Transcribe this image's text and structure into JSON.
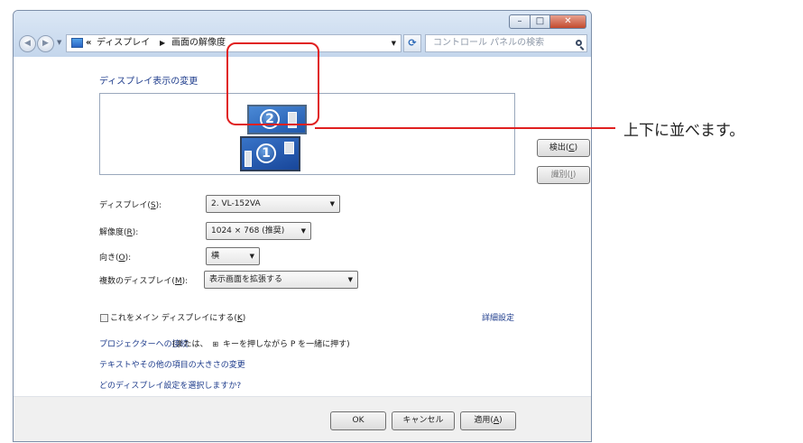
{
  "window": {
    "breadcrumb_chevron": "«",
    "breadcrumb": [
      "ディスプレイ",
      "画面の解像度"
    ],
    "search_placeholder": "コントロール パネルの検索"
  },
  "page": {
    "title": "ディスプレイ表示の変更",
    "detect_button": "検出(C)",
    "identify_button": "識別(I)",
    "monitor_numbers": [
      "2",
      "1"
    ]
  },
  "settings": {
    "display": {
      "label": "ディスプレイ(S):",
      "value": "2. VL-152VA"
    },
    "resolution": {
      "label": "解像度(R):",
      "value": "1024 × 768 (推奨)"
    },
    "orientation": {
      "label": "向き(O):",
      "value": "横"
    },
    "multiple": {
      "label": "複数のディスプレイ(M):",
      "value": "表示画面を拡張する"
    }
  },
  "main_display_checkbox": {
    "label": "これをメイン ディスプレイにする(K)",
    "checked": false
  },
  "links": {
    "advanced": "詳細設定",
    "projector": "プロジェクターへの接続",
    "text_size": "テキストやその他の項目の大きさの変更",
    "choose": "どのディスプレイ設定を選択しますか?"
  },
  "hint": {
    "before": "(または、",
    "after": "キーを押しながら P を一緒に押す)"
  },
  "footer": {
    "ok": "OK",
    "cancel": "キャンセル",
    "apply": "適用(A)"
  },
  "callout": "上下に並べます。",
  "colors": {
    "callout": "#e02020",
    "link": "#1e3c8c"
  }
}
